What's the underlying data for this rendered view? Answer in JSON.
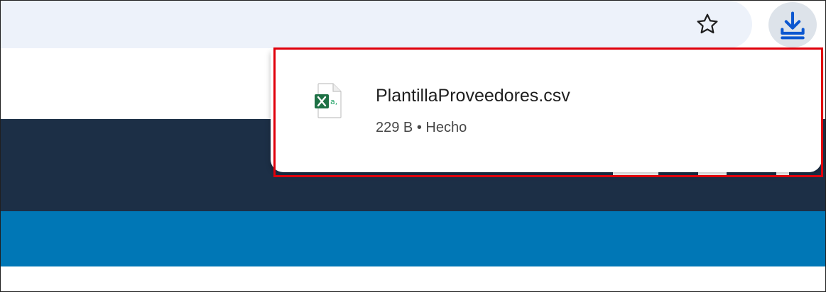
{
  "toolbar": {
    "bookmark_icon": "star-outline-icon",
    "download_icon": "download-arrow-icon",
    "accent_color": "#0b57d0"
  },
  "download_popup": {
    "item": {
      "file_icon": "excel-csv-file-icon",
      "file_name": "PlantillaProveedores.csv",
      "size": "229 B",
      "separator": "•",
      "status": "Hecho"
    },
    "highlight_color": "#e0000b"
  },
  "page": {
    "band_colors": [
      "#ffffff",
      "#1c2f46",
      "#0077b6",
      "#ffffff"
    ]
  }
}
